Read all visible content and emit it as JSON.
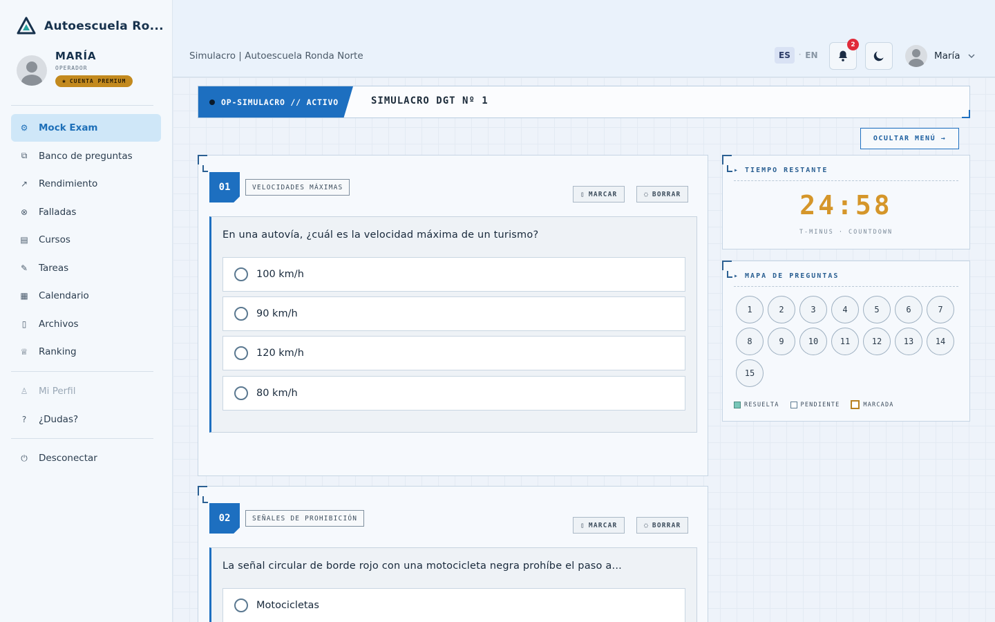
{
  "brand": {
    "name": "Autoescuela Ro..."
  },
  "profile": {
    "name": "MARÍA",
    "role": "OPERADOR",
    "badge": "CUENTA PREMIUM"
  },
  "nav": {
    "main": [
      {
        "label": "Mock Exam",
        "icon": "gear-icon"
      },
      {
        "label": "Banco de preguntas",
        "icon": "sitemap-icon"
      },
      {
        "label": "Rendimiento",
        "icon": "chart-icon"
      },
      {
        "label": "Falladas",
        "icon": "x-circle-icon"
      },
      {
        "label": "Cursos",
        "icon": "book-icon"
      },
      {
        "label": "Tareas",
        "icon": "edit-icon"
      },
      {
        "label": "Calendario",
        "icon": "calendar-icon"
      },
      {
        "label": "Archivos",
        "icon": "file-icon"
      },
      {
        "label": "Ranking",
        "icon": "trophy-icon"
      }
    ],
    "secondary": [
      {
        "label": "Mi Perfil",
        "icon": "user-icon"
      },
      {
        "label": "¿Dudas?",
        "icon": "help-icon"
      }
    ],
    "logout": {
      "label": "Desconectar",
      "icon": "power-icon"
    }
  },
  "topbar": {
    "title": "Simulacro | Autoescuela Ronda Norte",
    "lang_es": "ES",
    "lang_sep": "·",
    "lang_en": "EN",
    "notifications": "2",
    "user_name": "María"
  },
  "exam": {
    "status_tag": "OP-SIMULACRO // ACTIVO",
    "title": "SIMULACRO DGT Nº 1",
    "hide_menu": "OCULTAR MENÚ →",
    "mark_label": "MARCAR",
    "clear_label": "BORRAR",
    "questions": [
      {
        "number": "01",
        "category": "VELOCIDADES MÁXIMAS",
        "text": "En una autovía, ¿cuál es la velocidad máxima de un turismo?",
        "options": [
          "100 km/h",
          "90 km/h",
          "120 km/h",
          "80 km/h"
        ]
      },
      {
        "number": "02",
        "category": "SEÑALES DE PROHIBICIÓN",
        "text": "La señal circular de borde rojo con una motocicleta negra prohíbe el paso a...",
        "options": [
          "Motocicletas"
        ]
      }
    ]
  },
  "timer": {
    "title": "▸ TIEMPO RESTANTE",
    "value": "24:58",
    "subtitle": "T-MINUS · COUNTDOWN",
    "color": "#d5962a"
  },
  "question_map": {
    "title": "▸ MAPA DE PREGUNTAS",
    "numbers": [
      "1",
      "2",
      "3",
      "4",
      "5",
      "6",
      "7",
      "8",
      "9",
      "10",
      "11",
      "12",
      "13",
      "14",
      "15"
    ],
    "legend": {
      "resolved": "RESUELTA",
      "pending": "PENDIENTE",
      "marked": "MARCADA"
    }
  },
  "colors": {
    "accent": "#1d6fc0",
    "premium": "#c38a1e",
    "badge": "#e02b3a"
  }
}
